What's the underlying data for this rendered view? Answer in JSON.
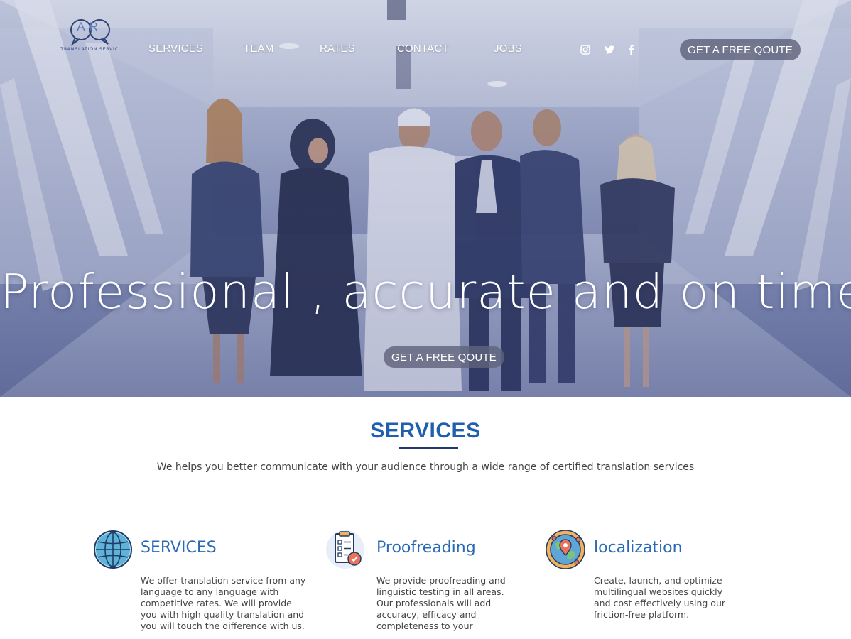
{
  "brand": {
    "logo_letters": "AR",
    "logo_text": "TRANSLATION SERVIC"
  },
  "nav": {
    "items": [
      "SERVICES",
      "TEAM",
      "RATES",
      "CONTACT",
      "JOBS"
    ]
  },
  "social": {
    "icons": [
      "instagram-icon",
      "twitter-icon",
      "facebook-icon"
    ]
  },
  "header": {
    "quote_button": "GET A FREE QOUTE"
  },
  "hero": {
    "headline": "Professional , accurate and on time",
    "quote_button": "GET A FREE QOUTE"
  },
  "services_section": {
    "title": "SERVICES",
    "subtitle": "We helps you better communicate with your audience through a wide range of certified translation services",
    "cards": [
      {
        "icon": "globe-icon",
        "title": "SERVICES",
        "lines": [
          "We offer translation service from any",
          "language to any language with",
          "competitive rates. We will provide",
          "you with high quality translation and",
          "you will touch the difference with us."
        ]
      },
      {
        "icon": "checklist-icon",
        "title": "Proofreading",
        "lines": [
          "We provide proofreading and",
          "linguistic testing in all areas.",
          "Our professionals will add",
          "accuracy, efficacy and",
          "completeness to your"
        ]
      },
      {
        "icon": "world-location-icon",
        "title": "localization",
        "lines": [
          "Create, launch, and optimize",
          "multilingual websites quickly",
          "and cost effectively using our",
          "friction-free platform."
        ]
      }
    ]
  },
  "colors": {
    "accent": "#1f5fae",
    "heading_blue": "#2a6ab5",
    "underline": "#213a6b",
    "button_bg": "#5f647d",
    "hero_tint": "#8e98bd"
  }
}
